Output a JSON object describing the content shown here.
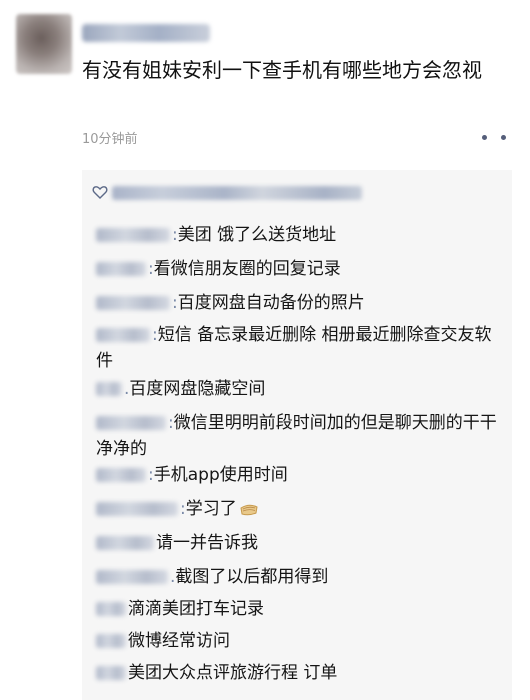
{
  "post": {
    "text": "有没有姐妹安利一下查手机有哪些地方会忽视",
    "time": "10分钟前"
  },
  "icons": {
    "like": "heart-icon",
    "more": "more-dots-icon",
    "emoji": "note-emoji-icon"
  },
  "comments": [
    {
      "sep": ":",
      "text": "美团 饿了么送货地址"
    },
    {
      "sep": ":",
      "text": "看微信朋友圈的回复记录"
    },
    {
      "sep": ":",
      "text": "百度网盘自动备份的照片"
    },
    {
      "sep": ":",
      "text": "短信 备忘录最近删除 相册最近删除查交友软件"
    },
    {
      "sep": ".",
      "text": "百度网盘隐藏空间"
    },
    {
      "sep": ":",
      "text": "微信里明明前段时间加的但是聊天删的干干净净的"
    },
    {
      "sep": ":",
      "text": "手机app使用时间"
    },
    {
      "sep": ":",
      "text": "学习了"
    },
    {
      "sep": "",
      "text": "请一并告诉我"
    },
    {
      "sep": ".",
      "text": "截图了以后都用得到"
    },
    {
      "sep": "",
      "text": "滴滴美团打车记录"
    },
    {
      "sep": "",
      "text": "微博经常访问"
    },
    {
      "sep": "",
      "text": "美团大众点评旅游行程 订单"
    }
  ]
}
